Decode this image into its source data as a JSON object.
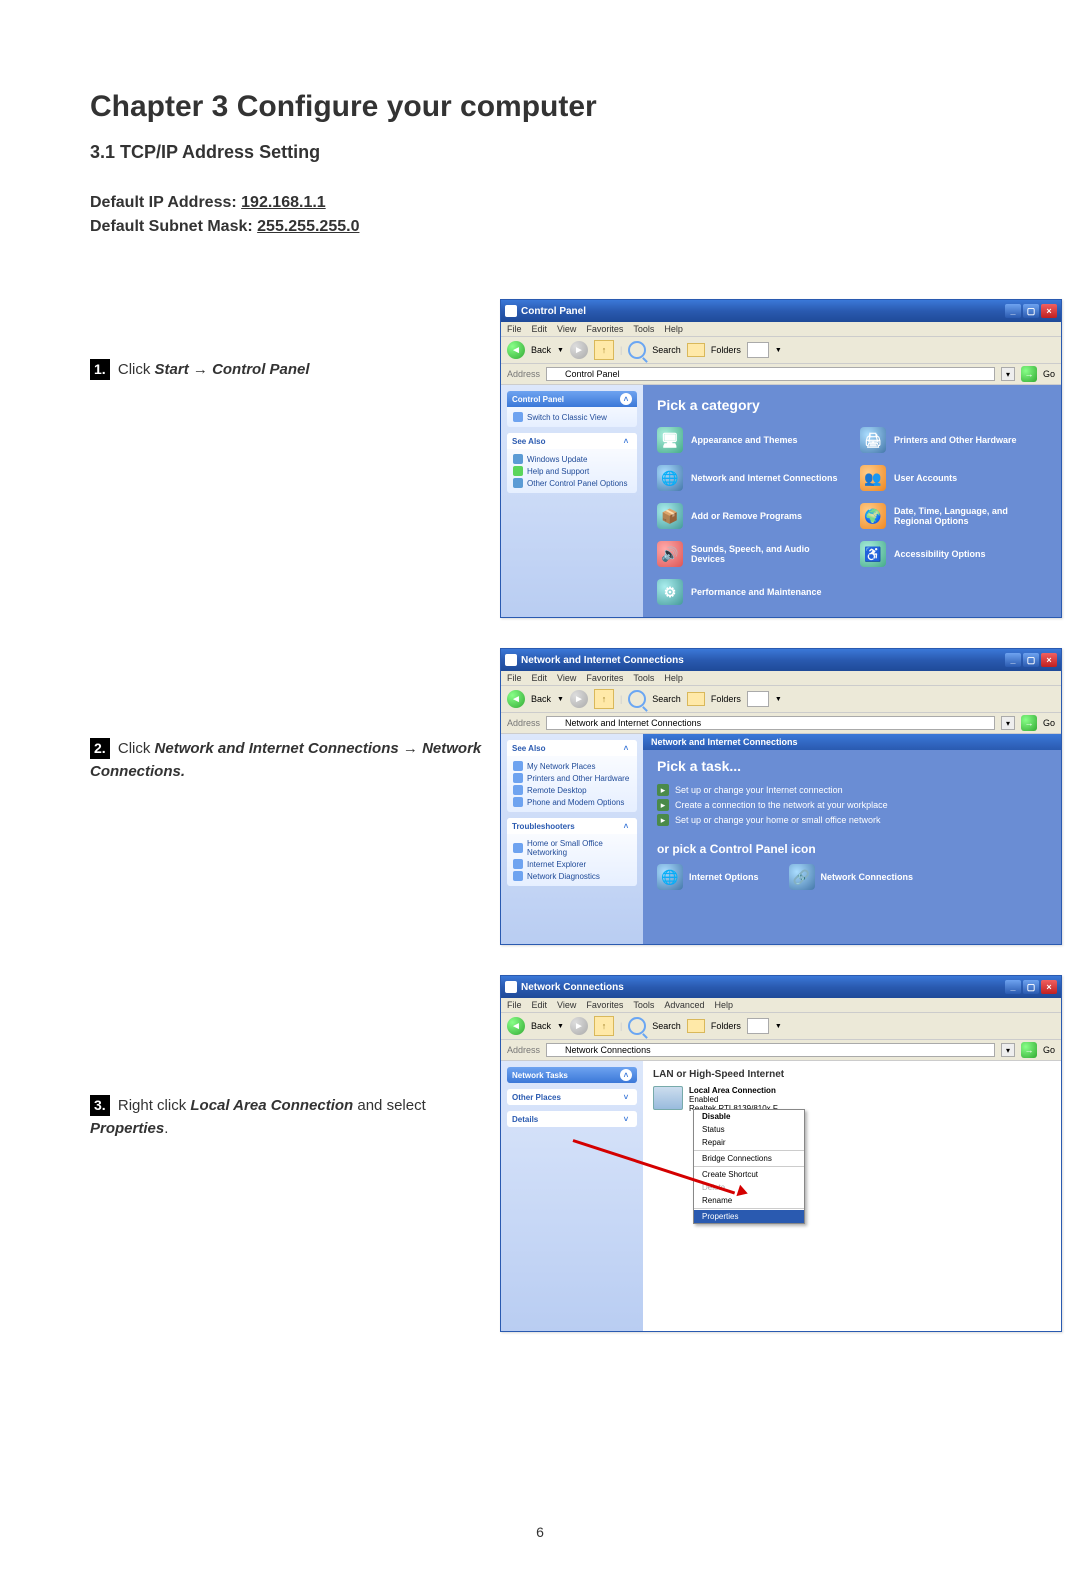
{
  "page_number": "6",
  "chapter_title": "Chapter 3 Configure your computer",
  "section_title": "3.1 TCP/IP Address Setting",
  "defaults": {
    "ip_label": "Default IP Address: ",
    "ip_value": "192.168.1.1",
    "mask_label": "Default Subnet Mask: ",
    "mask_value": "255.255.255.0"
  },
  "steps": [
    {
      "num": "1.",
      "pre": "Click ",
      "b1": "Start",
      "mid": " → ",
      "b2": "Control Panel"
    },
    {
      "num": "2.",
      "pre": "Click ",
      "b1": "Network and Internet Connections",
      "mid": " → ",
      "b2": "Network Connections.",
      "suffix": ""
    },
    {
      "num": "3.",
      "pre": "Right click ",
      "b1": "Local Area Connection",
      "mid": " and select ",
      "b2": "Properties",
      "suffix": "."
    }
  ],
  "xp": {
    "menus": [
      "File",
      "Edit",
      "View",
      "Favorites",
      "Tools",
      "Help"
    ],
    "menus_nc": [
      "File",
      "Edit",
      "View",
      "Favorites",
      "Tools",
      "Advanced",
      "Help"
    ],
    "toolbar": {
      "back": "Back",
      "search": "Search",
      "folders": "Folders"
    },
    "addr_label": "Address",
    "go": "Go"
  },
  "win1": {
    "title": "Control Panel",
    "address": "Control Panel",
    "side_h1": "Control Panel",
    "side_i1": "Switch to Classic View",
    "side_h2": "See Also",
    "see_also": [
      "Windows Update",
      "Help and Support",
      "Other Control Panel Options"
    ],
    "main_title": "Pick a category",
    "cats": [
      "Appearance and Themes",
      "Printers and Other Hardware",
      "Network and Internet Connections",
      "User Accounts",
      "Add or Remove Programs",
      "Date, Time, Language, and Regional Options",
      "Sounds, Speech, and Audio Devices",
      "Accessibility Options",
      "Performance and Maintenance"
    ]
  },
  "win2": {
    "title": "Network and Internet Connections",
    "address": "Network and Internet Connections",
    "header_bar": "Network and Internet Connections",
    "side_h1": "See Also",
    "see_also": [
      "My Network Places",
      "Printers and Other Hardware",
      "Remote Desktop",
      "Phone and Modem Options"
    ],
    "side_h2": "Troubleshooters",
    "troubleshooters": [
      "Home or Small Office Networking",
      "Internet Explorer",
      "Network Diagnostics"
    ],
    "task_title": "Pick a task...",
    "tasks": [
      "Set up or change your Internet connection",
      "Create a connection to the network at your workplace",
      "Set up or change your home or small office network"
    ],
    "or_title": "or pick a Control Panel icon",
    "icons": [
      "Internet Options",
      "Network Connections"
    ]
  },
  "win3": {
    "title": "Network Connections",
    "address": "Network Connections",
    "side_h1": "Network Tasks",
    "side_h2": "Other Places",
    "side_h3": "Details",
    "group": "LAN or High-Speed Internet",
    "conn_name": "Local Area Connection",
    "conn_status": "Enabled",
    "conn_device": "Realtek RTL8139/810x F...",
    "ctx": [
      "Disable",
      "Status",
      "Repair",
      "Bridge Connections",
      "Create Shortcut",
      "Delete",
      "Rename",
      "Properties"
    ]
  }
}
